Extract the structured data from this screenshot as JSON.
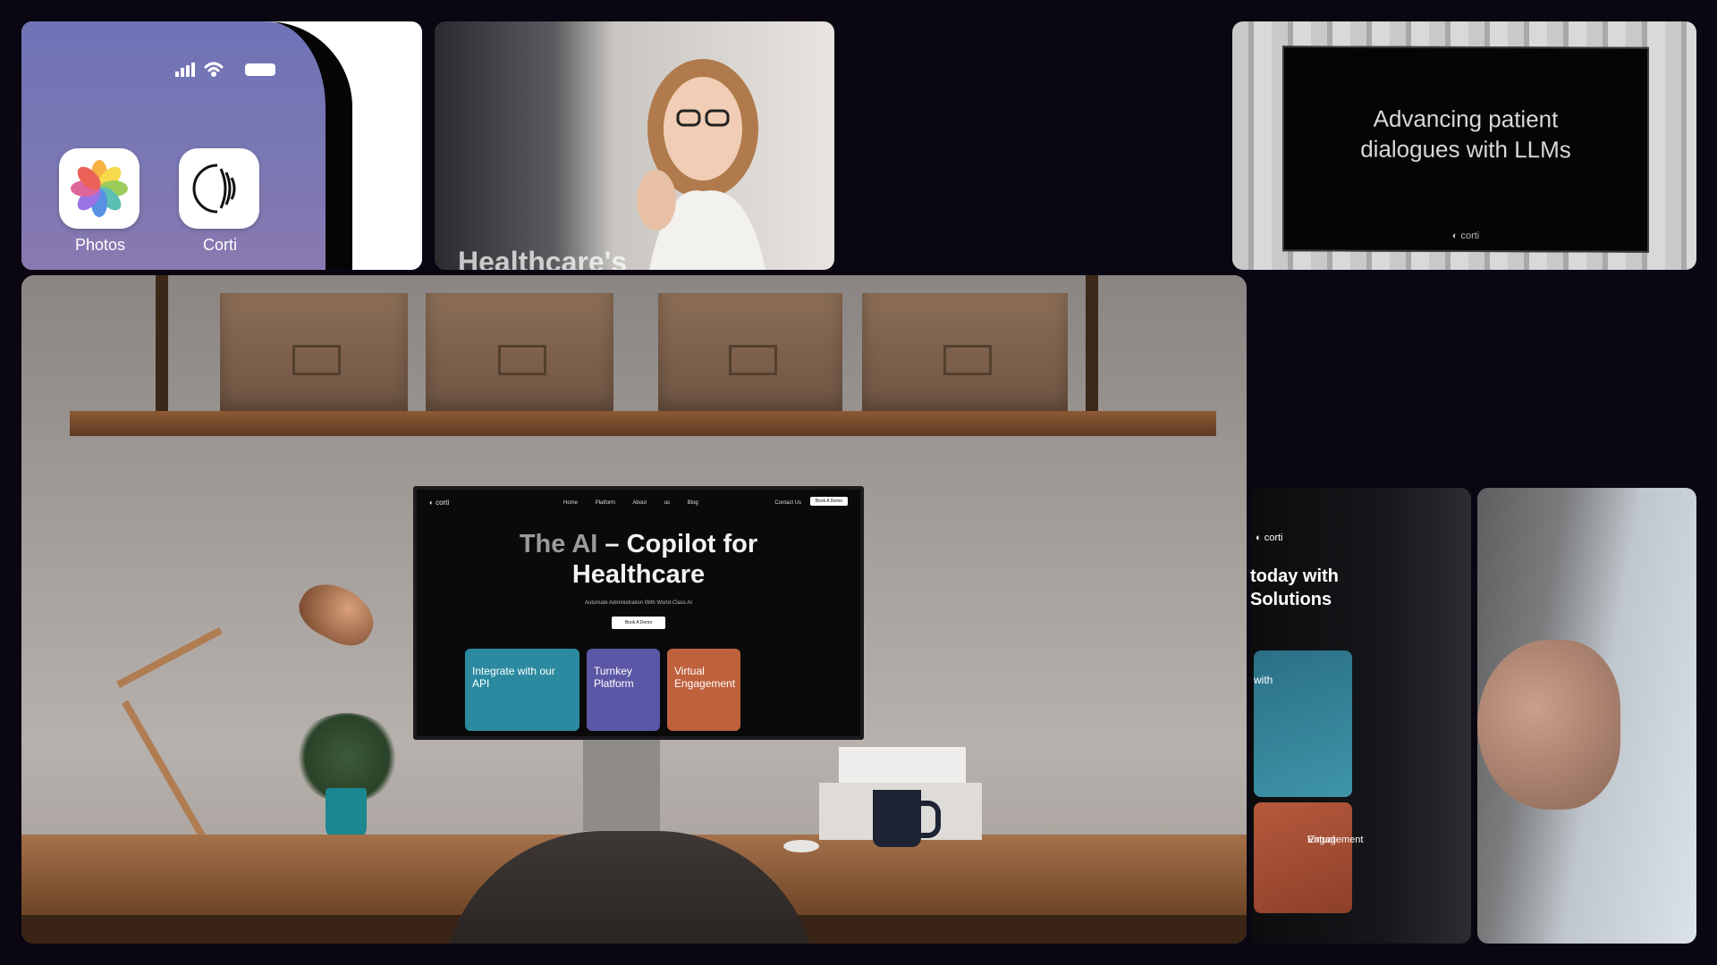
{
  "phone": {
    "apps": [
      {
        "label": "Photos",
        "icon": "photos-icon"
      },
      {
        "label": "Corti",
        "icon": "corti-logo-icon"
      }
    ]
  },
  "doctor": {
    "caption": "Healthcare's"
  },
  "llm_screen": {
    "title_line1": "Advancing patient",
    "title_line2": "dialogues with LLMs",
    "logo_text": "corti"
  },
  "monitor_site": {
    "logo_text": "corti",
    "nav_links": [
      "Home",
      "Platform",
      "About us",
      "Blog"
    ],
    "contact_label": "Contact Us",
    "demo_button": "Book A Demo",
    "title_dim": "The AI",
    "title_rest": " – Copilot for",
    "title_line2": "Healthcare",
    "subtitle": "Automate Administration With World-Class AI",
    "cta": "Book A Demo",
    "cards": [
      {
        "label": "Integrate with our API",
        "color": "#2b8aa0"
      },
      {
        "label": "Turnkey Platform",
        "color": "#5b57a6"
      },
      {
        "label": "Virtual Engagement",
        "color": "#c0613d"
      }
    ]
  },
  "mobile_site": {
    "logo_text": "corti",
    "headline_line1": "today with",
    "headline_line2": "Solutions",
    "card1_label": "with",
    "card2_label_line1": "Virtual",
    "card2_label_line2": "Engagement"
  },
  "colors": {
    "background": "#0a0612",
    "phone_wallpaper": "#7075b5",
    "teal": "#2b8aa0",
    "purple": "#5b57a6",
    "orange": "#c0613d"
  }
}
